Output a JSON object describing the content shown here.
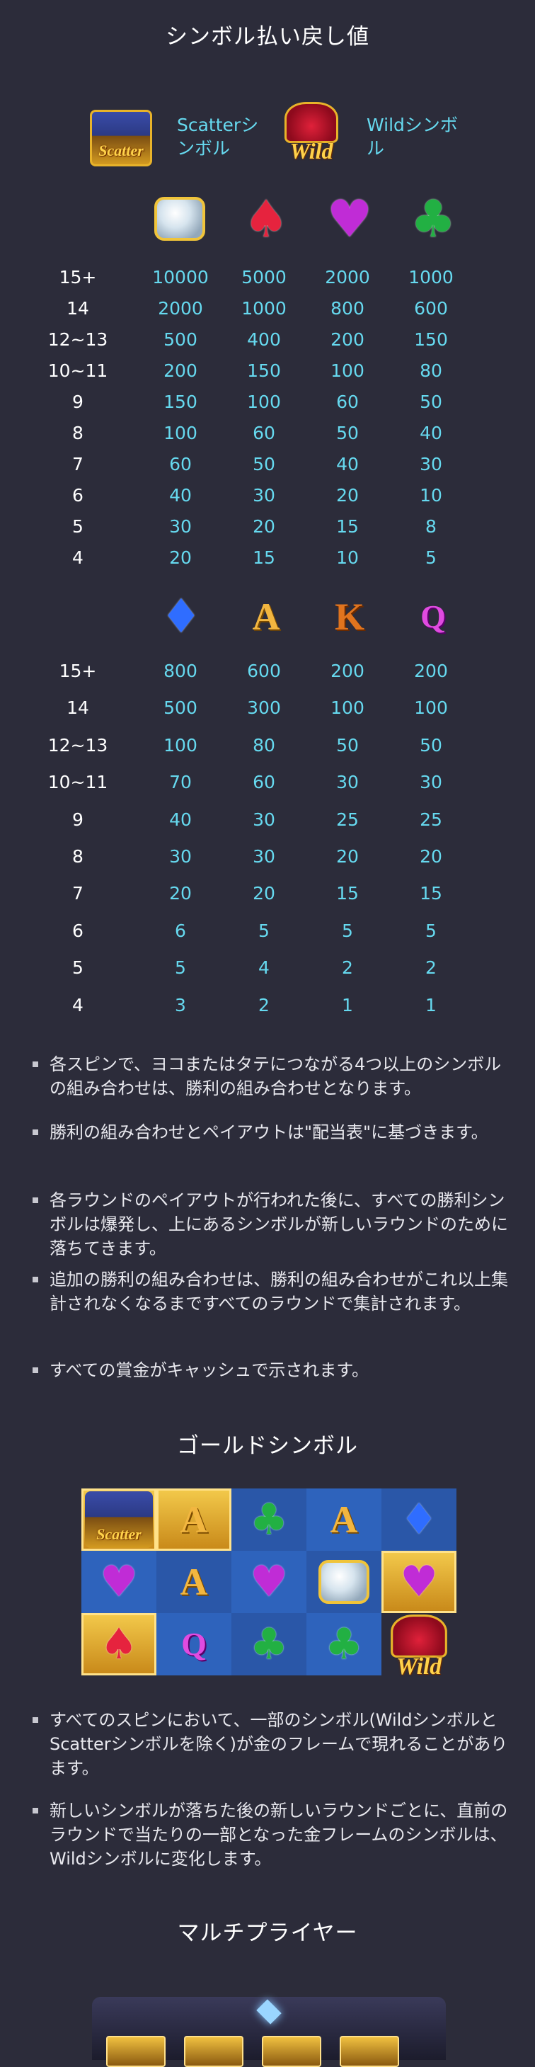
{
  "headings": {
    "payout": "シンボル払い戻し値",
    "gold": "ゴールドシンボル",
    "multiplier": "マルチプライヤー"
  },
  "specials": {
    "scatter_text": "Scatterシンボル",
    "wild_text": "Wildシンボル",
    "scatter_icon_label": "Scatter",
    "wild_icon_label": "Wild"
  },
  "paytable1": {
    "symbols": [
      "diamond-gem-icon",
      "spade-icon",
      "heart-icon",
      "club-icon"
    ],
    "rows": [
      {
        "count": "15+",
        "values": [
          "10000",
          "5000",
          "2000",
          "1000"
        ]
      },
      {
        "count": "14",
        "values": [
          "2000",
          "1000",
          "800",
          "600"
        ]
      },
      {
        "count": "12~13",
        "values": [
          "500",
          "400",
          "200",
          "150"
        ]
      },
      {
        "count": "10~11",
        "values": [
          "200",
          "150",
          "100",
          "80"
        ]
      },
      {
        "count": "9",
        "values": [
          "150",
          "100",
          "60",
          "50"
        ]
      },
      {
        "count": "8",
        "values": [
          "100",
          "60",
          "50",
          "40"
        ]
      },
      {
        "count": "7",
        "values": [
          "60",
          "50",
          "40",
          "30"
        ]
      },
      {
        "count": "6",
        "values": [
          "40",
          "30",
          "20",
          "10"
        ]
      },
      {
        "count": "5",
        "values": [
          "30",
          "20",
          "15",
          "8"
        ]
      },
      {
        "count": "4",
        "values": [
          "20",
          "15",
          "10",
          "5"
        ]
      }
    ]
  },
  "paytable2": {
    "symbols": [
      "diamond-suit-icon",
      "letter-a-icon",
      "letter-k-icon",
      "letter-q-icon"
    ],
    "icon_letters": [
      "A",
      "K",
      "Q"
    ],
    "rows": [
      {
        "count": "15+",
        "values": [
          "800",
          "600",
          "200",
          "200"
        ]
      },
      {
        "count": "14",
        "values": [
          "500",
          "300",
          "100",
          "100"
        ]
      },
      {
        "count": "12~13",
        "values": [
          "100",
          "80",
          "50",
          "50"
        ]
      },
      {
        "count": "10~11",
        "values": [
          "70",
          "60",
          "30",
          "30"
        ]
      },
      {
        "count": "9",
        "values": [
          "40",
          "30",
          "25",
          "25"
        ]
      },
      {
        "count": "8",
        "values": [
          "30",
          "30",
          "20",
          "20"
        ]
      },
      {
        "count": "7",
        "values": [
          "20",
          "20",
          "15",
          "15"
        ]
      },
      {
        "count": "6",
        "values": [
          "6",
          "5",
          "5",
          "5"
        ]
      },
      {
        "count": "5",
        "values": [
          "5",
          "4",
          "2",
          "2"
        ]
      },
      {
        "count": "4",
        "values": [
          "3",
          "2",
          "1",
          "1"
        ]
      }
    ]
  },
  "rules": [
    "各スピンで、ヨコまたはタテにつながる4つ以上のシンボルの組み合わせは、勝利の組み合わせとなります。",
    "勝利の組み合わせとペイアウトは\"配当表\"に基づきます。",
    "各ラウンドのペイアウトが行われた後に、すべての勝利シンボルは爆発し、上にあるシンボルが新しいラウンドのために落ちてきます。",
    "追加の勝利の組み合わせは、勝利の組み合わせがこれ以上集計されなくなるまですべてのラウンドで集計されます。",
    "すべての賞金がキャッシュで示されます。"
  ],
  "gold_rules": [
    "すべてのスピンにおいて、一部のシンボル(WildシンボルとScatterシンボルを除く)が金のフレームで現れることがあります。",
    "新しいシンボルが落ちた後の新しいラウンドごとに、直前のラウンドで当たりの一部となった金フレームのシンボルは、Wildシンボルに変化します。"
  ],
  "colors": {
    "background": "#2c2c3a",
    "value_text": "#66d9ef",
    "gold": "#e8b32a"
  }
}
